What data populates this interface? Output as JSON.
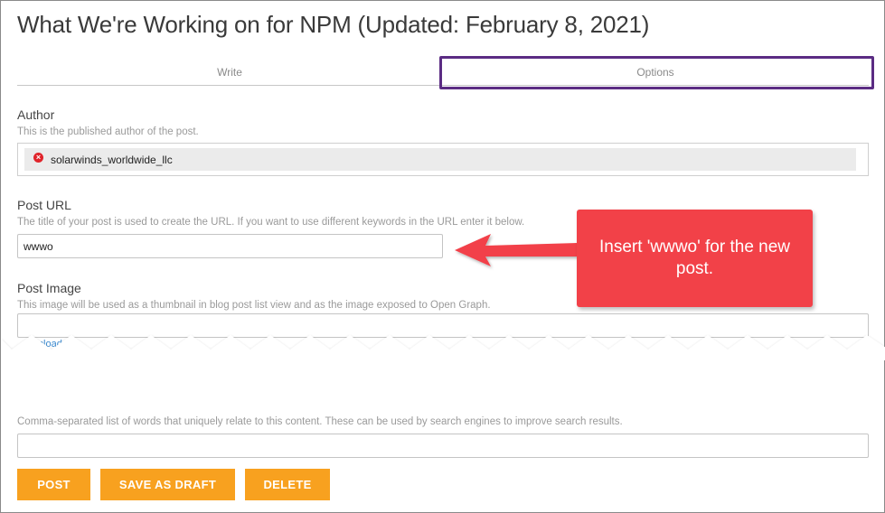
{
  "page": {
    "title": "What We're Working on for NPM (Updated: February 8, 2021)"
  },
  "tabs": [
    {
      "label": "Write"
    },
    {
      "label": "Options"
    }
  ],
  "author": {
    "label": "Author",
    "help": "This is the published author of the post.",
    "value": "solarwinds_worldwide_llc",
    "remove_icon": "×"
  },
  "post_url": {
    "label": "Post URL",
    "help": "The title of your post is used to create the URL. If you want to use different keywords in the URL enter it below.",
    "value": "wwwo"
  },
  "post_image": {
    "label": "Post Image",
    "help": "This image will be used as a thumbnail in blog post list view and as the image exposed to Open Graph.",
    "value": "",
    "upload_link": "Upload file"
  },
  "keywords": {
    "help": "Comma-separated list of words that uniquely relate to this content. These can be used by search engines to improve search results.",
    "value": ""
  },
  "buttons": {
    "post": "POST",
    "save_draft": "SAVE AS DRAFT",
    "delete": "DELETE"
  },
  "callout": {
    "text": "Insert 'wwwo' for the new post."
  },
  "colors": {
    "accent_button": "#f8a11f",
    "callout": "#f24148",
    "tab_highlight": "#5b2c83",
    "link": "#3b8ad0"
  }
}
